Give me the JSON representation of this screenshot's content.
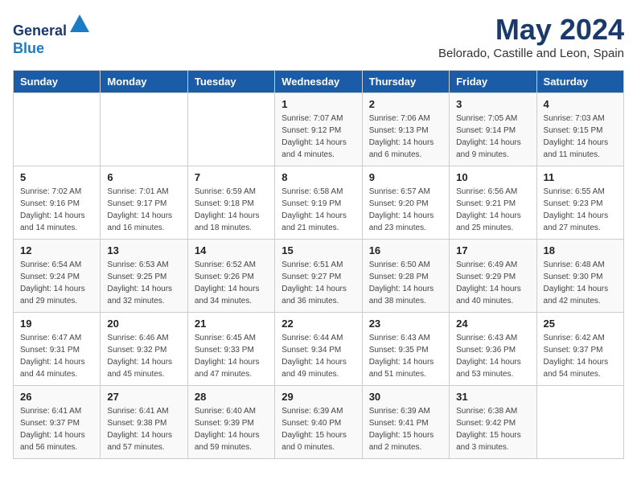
{
  "header": {
    "logo_line1": "General",
    "logo_line2": "Blue",
    "month": "May 2024",
    "location": "Belorado, Castille and Leon, Spain"
  },
  "days_of_week": [
    "Sunday",
    "Monday",
    "Tuesday",
    "Wednesday",
    "Thursday",
    "Friday",
    "Saturday"
  ],
  "weeks": [
    [
      {
        "day": "",
        "info": ""
      },
      {
        "day": "",
        "info": ""
      },
      {
        "day": "",
        "info": ""
      },
      {
        "day": "1",
        "info": "Sunrise: 7:07 AM\nSunset: 9:12 PM\nDaylight: 14 hours\nand 4 minutes."
      },
      {
        "day": "2",
        "info": "Sunrise: 7:06 AM\nSunset: 9:13 PM\nDaylight: 14 hours\nand 6 minutes."
      },
      {
        "day": "3",
        "info": "Sunrise: 7:05 AM\nSunset: 9:14 PM\nDaylight: 14 hours\nand 9 minutes."
      },
      {
        "day": "4",
        "info": "Sunrise: 7:03 AM\nSunset: 9:15 PM\nDaylight: 14 hours\nand 11 minutes."
      }
    ],
    [
      {
        "day": "5",
        "info": "Sunrise: 7:02 AM\nSunset: 9:16 PM\nDaylight: 14 hours\nand 14 minutes."
      },
      {
        "day": "6",
        "info": "Sunrise: 7:01 AM\nSunset: 9:17 PM\nDaylight: 14 hours\nand 16 minutes."
      },
      {
        "day": "7",
        "info": "Sunrise: 6:59 AM\nSunset: 9:18 PM\nDaylight: 14 hours\nand 18 minutes."
      },
      {
        "day": "8",
        "info": "Sunrise: 6:58 AM\nSunset: 9:19 PM\nDaylight: 14 hours\nand 21 minutes."
      },
      {
        "day": "9",
        "info": "Sunrise: 6:57 AM\nSunset: 9:20 PM\nDaylight: 14 hours\nand 23 minutes."
      },
      {
        "day": "10",
        "info": "Sunrise: 6:56 AM\nSunset: 9:21 PM\nDaylight: 14 hours\nand 25 minutes."
      },
      {
        "day": "11",
        "info": "Sunrise: 6:55 AM\nSunset: 9:23 PM\nDaylight: 14 hours\nand 27 minutes."
      }
    ],
    [
      {
        "day": "12",
        "info": "Sunrise: 6:54 AM\nSunset: 9:24 PM\nDaylight: 14 hours\nand 29 minutes."
      },
      {
        "day": "13",
        "info": "Sunrise: 6:53 AM\nSunset: 9:25 PM\nDaylight: 14 hours\nand 32 minutes."
      },
      {
        "day": "14",
        "info": "Sunrise: 6:52 AM\nSunset: 9:26 PM\nDaylight: 14 hours\nand 34 minutes."
      },
      {
        "day": "15",
        "info": "Sunrise: 6:51 AM\nSunset: 9:27 PM\nDaylight: 14 hours\nand 36 minutes."
      },
      {
        "day": "16",
        "info": "Sunrise: 6:50 AM\nSunset: 9:28 PM\nDaylight: 14 hours\nand 38 minutes."
      },
      {
        "day": "17",
        "info": "Sunrise: 6:49 AM\nSunset: 9:29 PM\nDaylight: 14 hours\nand 40 minutes."
      },
      {
        "day": "18",
        "info": "Sunrise: 6:48 AM\nSunset: 9:30 PM\nDaylight: 14 hours\nand 42 minutes."
      }
    ],
    [
      {
        "day": "19",
        "info": "Sunrise: 6:47 AM\nSunset: 9:31 PM\nDaylight: 14 hours\nand 44 minutes."
      },
      {
        "day": "20",
        "info": "Sunrise: 6:46 AM\nSunset: 9:32 PM\nDaylight: 14 hours\nand 45 minutes."
      },
      {
        "day": "21",
        "info": "Sunrise: 6:45 AM\nSunset: 9:33 PM\nDaylight: 14 hours\nand 47 minutes."
      },
      {
        "day": "22",
        "info": "Sunrise: 6:44 AM\nSunset: 9:34 PM\nDaylight: 14 hours\nand 49 minutes."
      },
      {
        "day": "23",
        "info": "Sunrise: 6:43 AM\nSunset: 9:35 PM\nDaylight: 14 hours\nand 51 minutes."
      },
      {
        "day": "24",
        "info": "Sunrise: 6:43 AM\nSunset: 9:36 PM\nDaylight: 14 hours\nand 53 minutes."
      },
      {
        "day": "25",
        "info": "Sunrise: 6:42 AM\nSunset: 9:37 PM\nDaylight: 14 hours\nand 54 minutes."
      }
    ],
    [
      {
        "day": "26",
        "info": "Sunrise: 6:41 AM\nSunset: 9:37 PM\nDaylight: 14 hours\nand 56 minutes."
      },
      {
        "day": "27",
        "info": "Sunrise: 6:41 AM\nSunset: 9:38 PM\nDaylight: 14 hours\nand 57 minutes."
      },
      {
        "day": "28",
        "info": "Sunrise: 6:40 AM\nSunset: 9:39 PM\nDaylight: 14 hours\nand 59 minutes."
      },
      {
        "day": "29",
        "info": "Sunrise: 6:39 AM\nSunset: 9:40 PM\nDaylight: 15 hours\nand 0 minutes."
      },
      {
        "day": "30",
        "info": "Sunrise: 6:39 AM\nSunset: 9:41 PM\nDaylight: 15 hours\nand 2 minutes."
      },
      {
        "day": "31",
        "info": "Sunrise: 6:38 AM\nSunset: 9:42 PM\nDaylight: 15 hours\nand 3 minutes."
      },
      {
        "day": "",
        "info": ""
      }
    ]
  ]
}
